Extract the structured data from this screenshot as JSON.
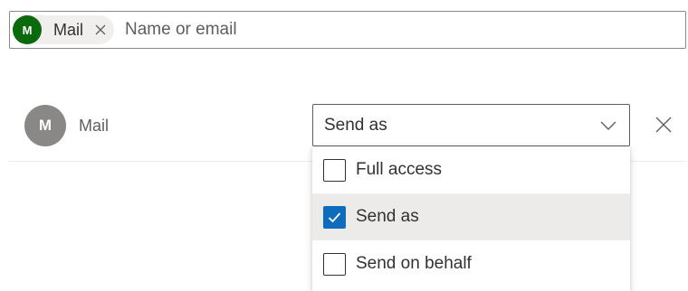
{
  "picker": {
    "chip": {
      "initial": "M",
      "label": "Mail"
    },
    "placeholder": "Name or email"
  },
  "member": {
    "initial": "M",
    "name": "Mail"
  },
  "permission_select": {
    "value": "Send as",
    "options": [
      {
        "label": "Full access",
        "checked": false
      },
      {
        "label": "Send as",
        "checked": true
      },
      {
        "label": "Send on behalf",
        "checked": false
      }
    ]
  },
  "colors": {
    "chip_avatar": "#0b6a0b",
    "member_avatar": "#8a8886",
    "checkbox_checked": "#0f6cbd",
    "selected_row": "#edebe9"
  },
  "icons": {
    "chip_remove": "close-icon",
    "select_chevron": "chevron-down-icon",
    "row_remove": "close-icon",
    "checkmark": "checkmark-icon"
  }
}
